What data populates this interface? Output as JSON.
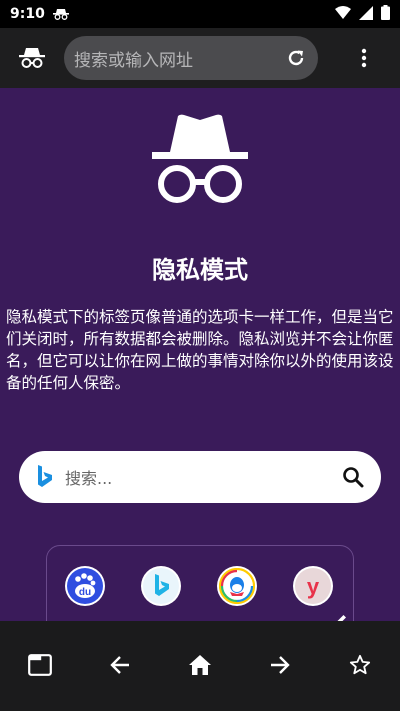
{
  "status": {
    "time": "9:10"
  },
  "toolbar": {
    "url_placeholder": "搜索或输入网址"
  },
  "incognito": {
    "title": "隐私模式",
    "description": "隐私模式下的标签页像普通的选项卡一样工作，但是当它们关闭时，所有数据都会被删除。隐私浏览并不会让你匿名，但它可以让你在网上做的事情对除你以外的使用该设备的任何人保密。"
  },
  "search": {
    "placeholder": "搜索..."
  },
  "shortcuts": [
    {
      "name": "baidu",
      "label": "du",
      "color": "#2f4ee0"
    },
    {
      "name": "bing",
      "color": "#1fb3e6"
    },
    {
      "name": "qq",
      "color": "#ffcc00"
    },
    {
      "name": "youku",
      "label": "y",
      "color": "#e8324a"
    }
  ],
  "colors": {
    "background": "#3a1b5a",
    "toolbar": "#1e1e1f",
    "bottom_nav": "#1b1b1c"
  }
}
